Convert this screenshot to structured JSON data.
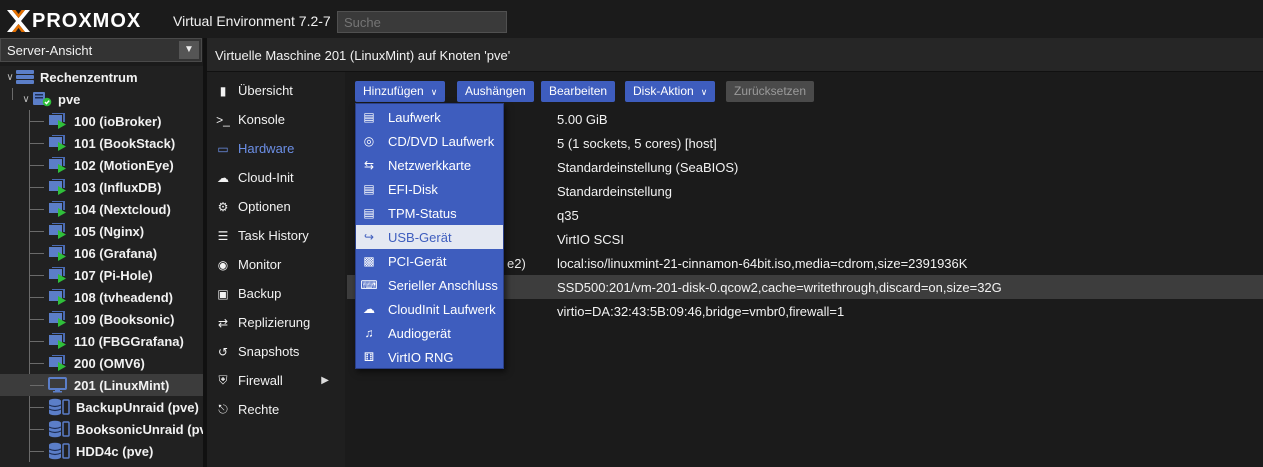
{
  "app": {
    "brand": "PROXMOX",
    "product": "Virtual Environment 7.2-7",
    "search_placeholder": "Suche"
  },
  "view_select": {
    "value": "Server-Ansicht"
  },
  "tree": {
    "datacenter": "Rechenzentrum",
    "node": "pve",
    "vms": [
      {
        "label": "100 (ioBroker)",
        "running": true
      },
      {
        "label": "101 (BookStack)",
        "running": true
      },
      {
        "label": "102 (MotionEye)",
        "running": true
      },
      {
        "label": "103 (InfluxDB)",
        "running": true
      },
      {
        "label": "104 (Nextcloud)",
        "running": true
      },
      {
        "label": "105 (Nginx)",
        "running": true
      },
      {
        "label": "106 (Grafana)",
        "running": true
      },
      {
        "label": "107 (Pi-Hole)",
        "running": true
      },
      {
        "label": "108 (tvheadend)",
        "running": true
      },
      {
        "label": "109 (Booksonic)",
        "running": true
      },
      {
        "label": "110 (FBGGrafana)",
        "running": true
      },
      {
        "label": "200 (OMV6)",
        "running": true
      },
      {
        "label": "201 (LinuxMint)",
        "running": false
      }
    ],
    "storages": [
      "BackupUnraid (pve)",
      "BooksonicUnraid (pve",
      "HDD4c (pve)"
    ]
  },
  "title": "Virtuelle Maschine 201 (LinuxMint) auf Knoten 'pve'",
  "nav": [
    {
      "label": "Übersicht",
      "icon": "book-icon"
    },
    {
      "label": "Konsole",
      "icon": "terminal-icon"
    },
    {
      "label": "Hardware",
      "icon": "desktop-icon",
      "active": true
    },
    {
      "label": "Cloud-Init",
      "icon": "cloud-icon"
    },
    {
      "label": "Optionen",
      "icon": "gear-icon"
    },
    {
      "label": "Task History",
      "icon": "list-icon"
    },
    {
      "label": "Monitor",
      "icon": "eye-icon"
    },
    {
      "label": "Backup",
      "icon": "floppy-icon"
    },
    {
      "label": "Replizierung",
      "icon": "retweet-icon"
    },
    {
      "label": "Snapshots",
      "icon": "history-icon"
    },
    {
      "label": "Firewall",
      "icon": "shield-icon"
    },
    {
      "label": "Rechte",
      "icon": "unlock-icon"
    }
  ],
  "toolbar": {
    "add": "Hinzufügen",
    "detach": "Aushängen",
    "edit": "Bearbeiten",
    "disk_action": "Disk-Aktion",
    "revert": "Zurücksetzen"
  },
  "hardware_rows": [
    {
      "label": "",
      "value": "5.00 GiB"
    },
    {
      "label": "",
      "value": "5 (1 sockets, 5 cores) [host]"
    },
    {
      "label": "",
      "value": "Standardeinstellung (SeaBIOS)"
    },
    {
      "label": "",
      "value": "Standardeinstellung"
    },
    {
      "label": "",
      "value": "q35"
    },
    {
      "label": "",
      "value": "VirtIO SCSI"
    },
    {
      "label": "e2)",
      "value": "local:iso/linuxmint-21-cinnamon-64bit.iso,media=cdrom,size=2391936K"
    },
    {
      "label": "",
      "value": "SSD500:201/vm-201-disk-0.qcow2,cache=writethrough,discard=on,size=32G",
      "selected": true
    },
    {
      "label": "",
      "value": "virtio=DA:32:43:5B:09:46,bridge=vmbr0,firewall=1"
    }
  ],
  "add_menu": [
    {
      "label": "Laufwerk",
      "icon": "hdd-icon"
    },
    {
      "label": "CD/DVD Laufwerk",
      "icon": "cdrom-icon"
    },
    {
      "label": "Netzwerkkarte",
      "icon": "exchange-icon"
    },
    {
      "label": "EFI-Disk",
      "icon": "hdd-icon"
    },
    {
      "label": "TPM-Status",
      "icon": "hdd-icon"
    },
    {
      "label": "USB-Gerät",
      "icon": "usb-icon",
      "hover": true
    },
    {
      "label": "PCI-Gerät",
      "icon": "pci-card-icon"
    },
    {
      "label": "Serieller Anschluss",
      "icon": "keyboard-icon"
    },
    {
      "label": "CloudInit Laufwerk",
      "icon": "cloud-icon"
    },
    {
      "label": "Audiogerät",
      "icon": "volume-icon"
    },
    {
      "label": "VirtIO RNG",
      "icon": "dice-icon"
    }
  ],
  "colors": {
    "accent": "#3e5dbe",
    "active_nav": "#6c8fe6",
    "running": "#2fbf3a",
    "logo_orange": "#e57000"
  }
}
